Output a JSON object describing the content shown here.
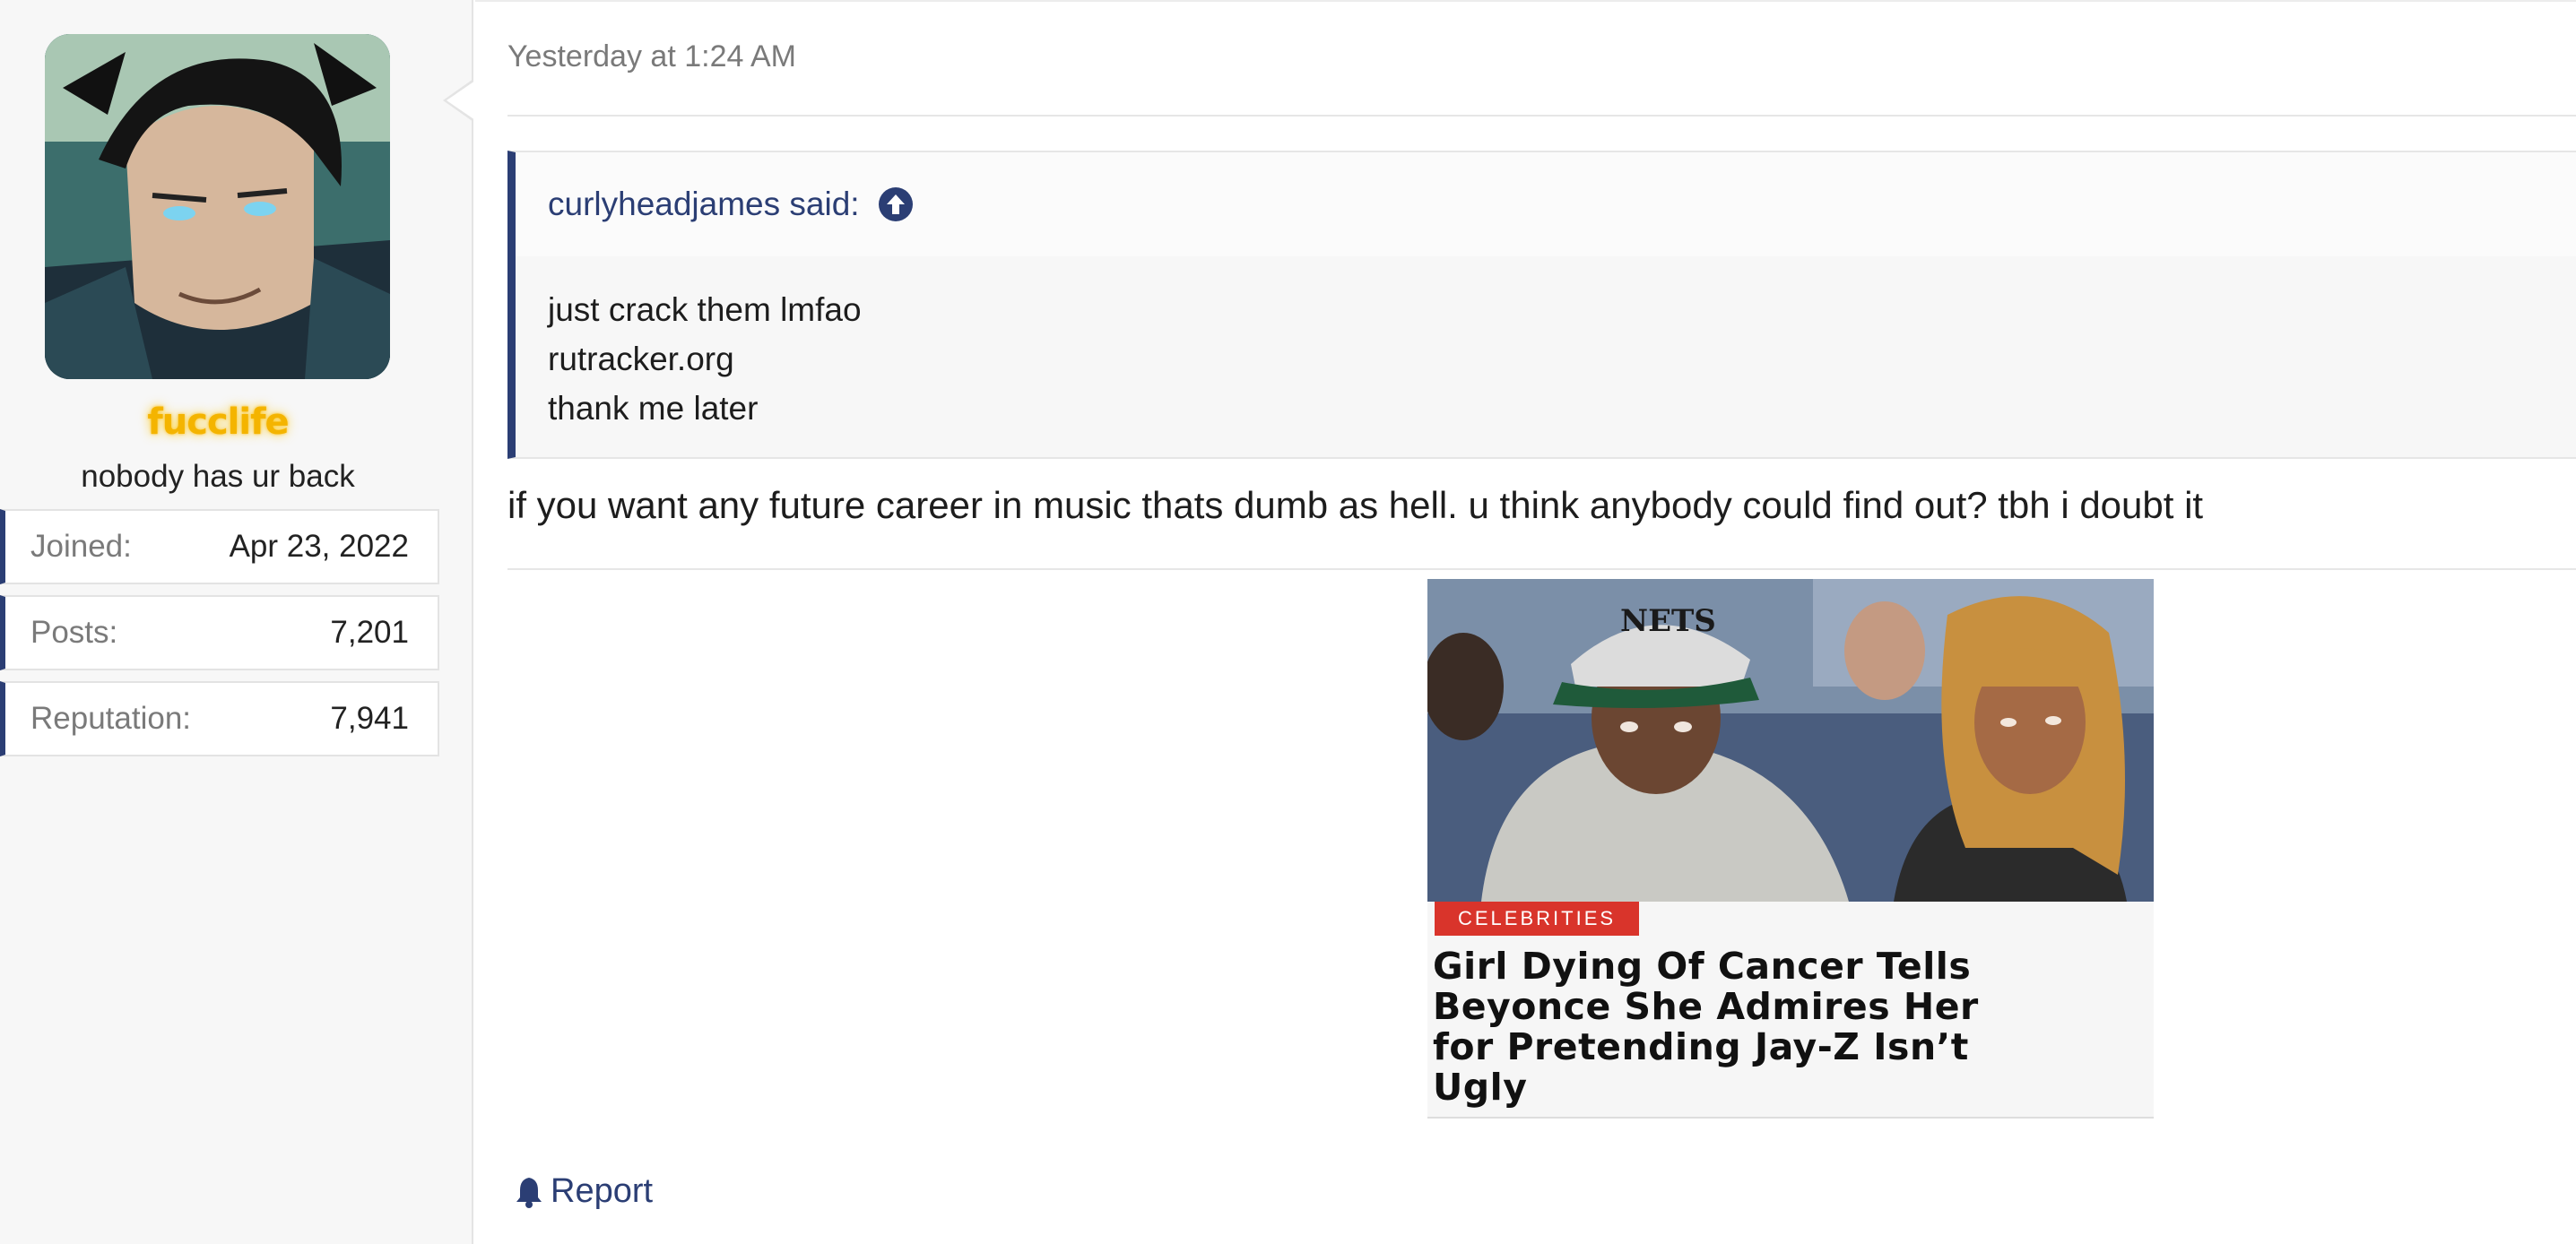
{
  "user": {
    "username": "fucclife",
    "user_title": "nobody has ur back",
    "username_color": "#f4b400",
    "stats": [
      {
        "label": "Joined:",
        "value": "Apr 23, 2022"
      },
      {
        "label": "Posts:",
        "value": "7,201"
      },
      {
        "label": "Reputation:",
        "value": "7,941"
      }
    ]
  },
  "post": {
    "date": "Yesterday at 1:24 AM",
    "quote": {
      "author_line": "curlyheadjames said:",
      "icon": "arrow-circle-up-icon",
      "lines": [
        "just crack them lmfao",
        "rutracker.org",
        "thank me later"
      ]
    },
    "text": "if you want any future career in music thats dumb as hell. u think anybody could find out? tbh i doubt it",
    "embed": {
      "badge": "CELEBRITIES",
      "headline_lines": [
        "Girl Dying Of Cancer Tells",
        "Beyonce She Admires Her",
        "for Pretending Jay-Z Isn’t",
        "Ugly"
      ],
      "cap_text": "NETS"
    },
    "report_label": "Report",
    "report_icon": "bell-icon"
  },
  "colors": {
    "accent": "#2b3e74",
    "badge": "#d9342b"
  }
}
